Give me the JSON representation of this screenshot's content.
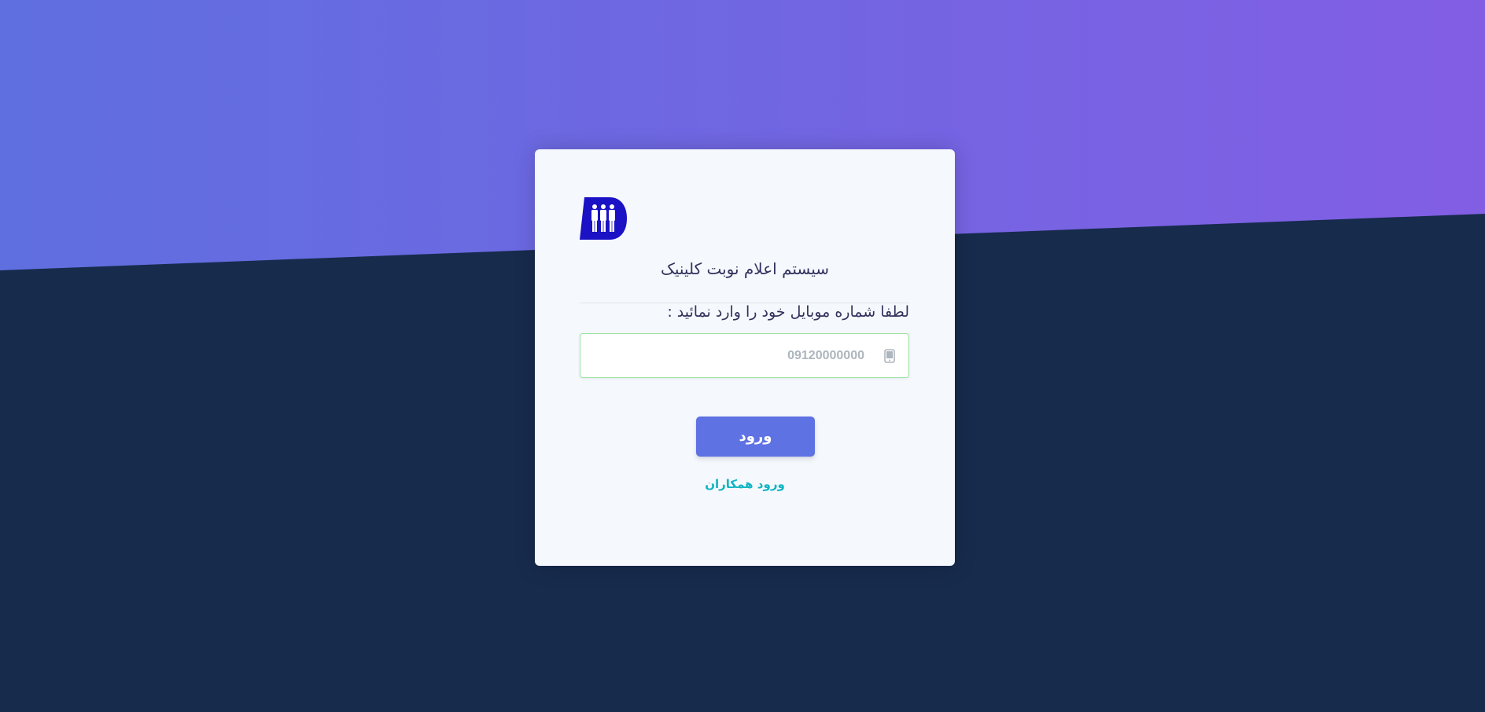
{
  "theme": {
    "gradient_start": "#5f6fe0",
    "gradient_end": "#825ee4",
    "background": "#172b4d",
    "card_background": "#f5f8fc",
    "primary": "#5e72e4",
    "link": "#11b5c2",
    "input_border": "#9ce3a2",
    "logo_blue": "#1a12c4"
  },
  "login": {
    "logo_icon": "clinic-people-logo",
    "title": "سیستم اعلام نوبت کلینیک",
    "prompt": "لطفا شماره موبایل خود را وارد نمائید :",
    "phone_placeholder": "09120000000",
    "phone_icon": "mobile-phone-icon",
    "submit_label": "ورود",
    "colleague_link": "ورود همکاران"
  }
}
